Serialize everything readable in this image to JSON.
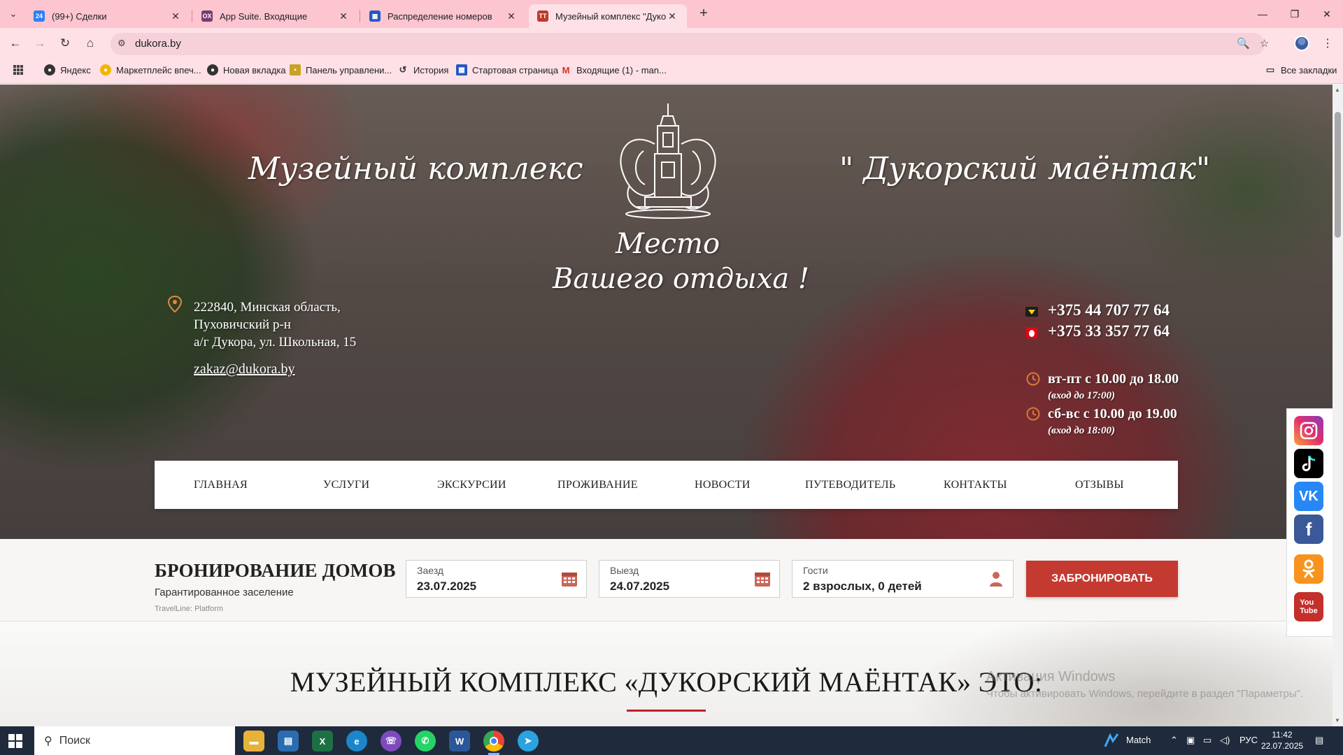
{
  "browser": {
    "tabs": [
      {
        "label": "(99+) Сделки",
        "favicon": "24",
        "favicon_color": "#2d7ff9",
        "active": false
      },
      {
        "label": "App Suite. Входящие",
        "favicon": "OX",
        "favicon_color": "#7a3a6e",
        "active": false
      },
      {
        "label": "Распределение номеров",
        "favicon": "▦",
        "favicon_color": "#2757c7",
        "active": false
      },
      {
        "label": "Музейный комплекс \"Дукорс",
        "favicon": "TT",
        "favicon_color": "#c0392b",
        "active": true
      }
    ],
    "new_tab": "+",
    "address": "dukora.by",
    "bookmarks": [
      {
        "label": "Яндекс",
        "icon": "yandex-icon"
      },
      {
        "label": "Маркетплейс впеч...",
        "icon": "marketplace-icon"
      },
      {
        "label": "Новая вкладка",
        "icon": "new-tab-icon"
      },
      {
        "label": "Панель управлени...",
        "icon": "panel-icon"
      },
      {
        "label": "История",
        "icon": "history-icon"
      },
      {
        "label": "Стартовая страница",
        "icon": "start-page-icon"
      },
      {
        "label": "Входящие (1) - man...",
        "icon": "gmail-icon"
      }
    ],
    "all_bookmarks": "Все закладки"
  },
  "hero": {
    "left_script": "Музейный комплекс",
    "right_script": "\" Дукорский маёнтак\"",
    "slogan_line1": "Место",
    "slogan_line2": "Вашего отдыха !",
    "address_line1": "222840, Минская область,",
    "address_line2": "Пуховичский р-н",
    "address_line3": "а/г Дукора, ул. Школьная, 15",
    "email": "zakaz@dukora.by",
    "phone1": "+375 44 707 77 64",
    "phone2": "+375 33 357 77 64",
    "hours1": "вт-пт с 10.00 до 18.00",
    "hours1_note": "(вход до 17:00)",
    "hours2": "сб-вс с 10.00 до 19.00",
    "hours2_note": "(вход до 18:00)"
  },
  "menu": [
    "ГЛАВНАЯ",
    "УСЛУГИ",
    "ЭКСКУРСИИ",
    "ПРОЖИВАНИЕ",
    "НОВОСТИ",
    "ПУТЕВОДИТЕЛЬ",
    "КОНТАКТЫ",
    "ОТЗЫВЫ"
  ],
  "socials": [
    "instagram-icon",
    "tiktok-icon",
    "vk-icon",
    "facebook-icon",
    "odnoklassniki-icon",
    "youtube-icon"
  ],
  "booking": {
    "title": "БРОНИРОВАНИЕ ДОМОВ",
    "subtitle": "Гарантированное заселение",
    "platform": "TravelLine: Platform",
    "checkin_label": "Заезд",
    "checkin_value": "23.07.2025",
    "checkout_label": "Выезд",
    "checkout_value": "24.07.2025",
    "guests_label": "Гости",
    "guests_value": "2 взрослых, 0 детей",
    "button": "ЗАБРОНИРОВАТЬ"
  },
  "about": {
    "title": "МУЗЕЙНЫЙ КОМПЛЕКС «ДУКОРСКИЙ МАЁНТАК» ЭТО:"
  },
  "watermark": {
    "line1": "Активация Windows",
    "line2": "Чтобы активировать Windows, перейдите в раздел \"Параметры\"."
  },
  "taskbar": {
    "search": "Поиск",
    "weather": "Match",
    "lang": "РУС",
    "time": "11:42",
    "date": "22.07.2025"
  },
  "colors": {
    "tabbar": "#fcc5d0",
    "accent_red": "#c43a31",
    "underline_red": "#c21f2a"
  }
}
